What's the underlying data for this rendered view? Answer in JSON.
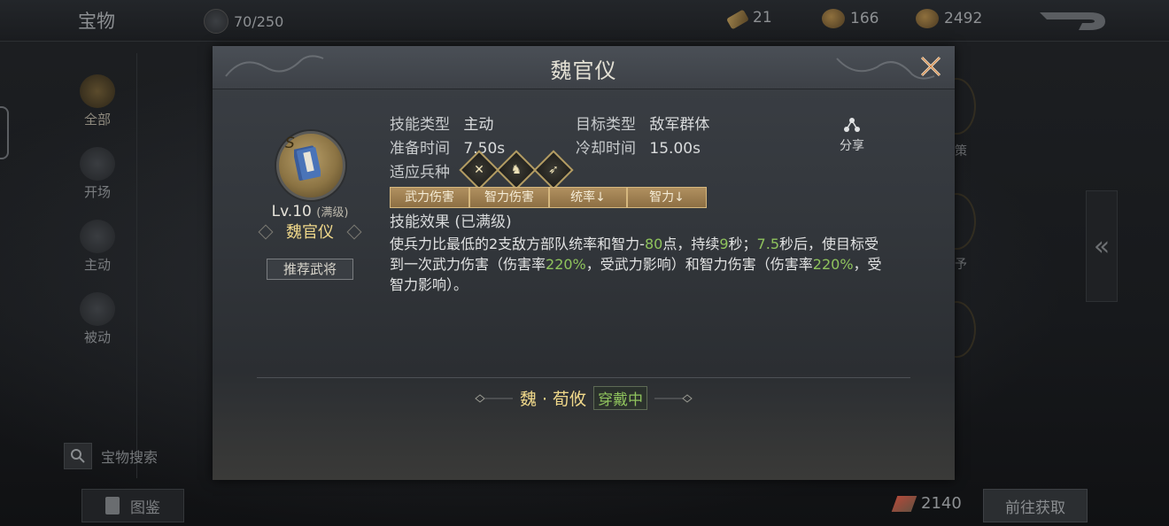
{
  "header": {
    "title": "宝物",
    "capacity": "70/250",
    "resource_scroll": "21",
    "resource_coin": "166",
    "resource_gold": "2492"
  },
  "sidebar": {
    "items": [
      {
        "label": "全部",
        "active": true
      },
      {
        "label": "开场",
        "active": false
      },
      {
        "label": "主动",
        "active": false
      },
      {
        "label": "被动",
        "active": false
      }
    ],
    "search_label": "宝物搜索"
  },
  "footer": {
    "atlas_label": "图鉴",
    "points": "2140",
    "goto_label": "前往获取"
  },
  "right_panel": {
    "ghost_text_1": "策",
    "ghost_text_2": "予",
    "arrow": "«"
  },
  "modal": {
    "title": "魏官仪",
    "grade": "S",
    "level": "Lv.10",
    "level_note": "(满级)",
    "skill_name": "魏官仪",
    "recommend_label": "推荐武将",
    "skill_type_key": "技能类型",
    "skill_type_value": "主动",
    "target_type_key": "目标类型",
    "target_type_value": "敌军群体",
    "prep_time_key": "准备时间",
    "prep_time_value": "7.50s",
    "cooldown_key": "冷却时间",
    "cooldown_value": "15.00s",
    "troops_key": "适应兵种",
    "tags": [
      "武力伤害",
      "智力伤害",
      "统率↓",
      "智力↓"
    ],
    "effect_title": "技能效果 (已满级)",
    "share_label": "分享",
    "desc": {
      "p1": "使兵力比最低的2支敌方部队统率和智力-",
      "v1": "80",
      "p2": "点，持续",
      "v2": "9",
      "p3": "秒；",
      "v3": "7.5",
      "p4": "秒后，使目标受到一次武力伤害（伤害率",
      "v4": "220%",
      "p5": "，受武力影响）和智力伤害（伤害率",
      "v5": "220%",
      "p6": "，受智力影响）。"
    },
    "equipped_general": "魏 · 荀攸",
    "equipped_status": "穿戴中"
  },
  "colors": {
    "gold_text": "#f0d88a",
    "green_highlight": "#8fc35d",
    "tag_bg": "#a08258"
  }
}
